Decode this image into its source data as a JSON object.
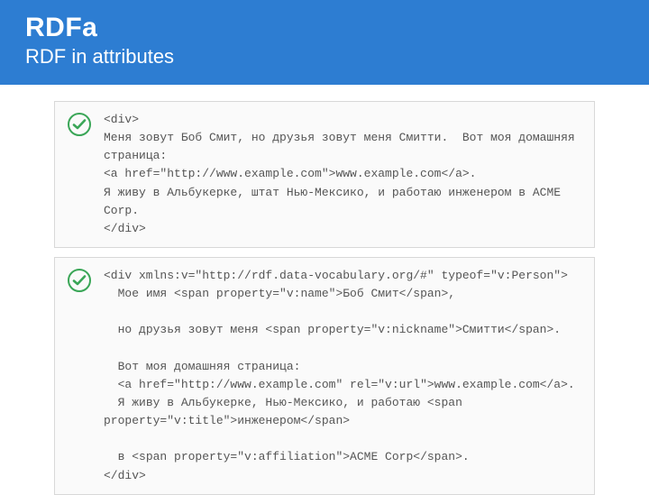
{
  "header": {
    "title": "RDFa",
    "subtitle": "RDF in attributes"
  },
  "cards": [
    {
      "code": "<div>\nМеня зовут Боб Смит, но друзья зовут меня Смитти.  Вот моя домашняя страница:\n<a href=\"http://www.example.com\">www.example.com</a>.\nЯ живу в Альбукерке, штат Нью-Мексико, и работаю инженером в ACME Corp.\n</div>"
    },
    {
      "code": "<div xmlns:v=\"http://rdf.data-vocabulary.org/#\" typeof=\"v:Person\">\n  Мое имя <span property=\"v:name\">Боб Смит</span>,\n\n  но друзья зовут меня <span property=\"v:nickname\">Смитти</span>.\n\n  Вот моя домашняя страница:\n  <a href=\"http://www.example.com\" rel=\"v:url\">www.example.com</a>.\n  Я живу в Альбукерке, Нью-Мексико, и работаю <span property=\"v:title\">инженером</span>\n\n  в <span property=\"v:affiliation\">ACME Corp</span>.\n</div>"
    }
  ]
}
